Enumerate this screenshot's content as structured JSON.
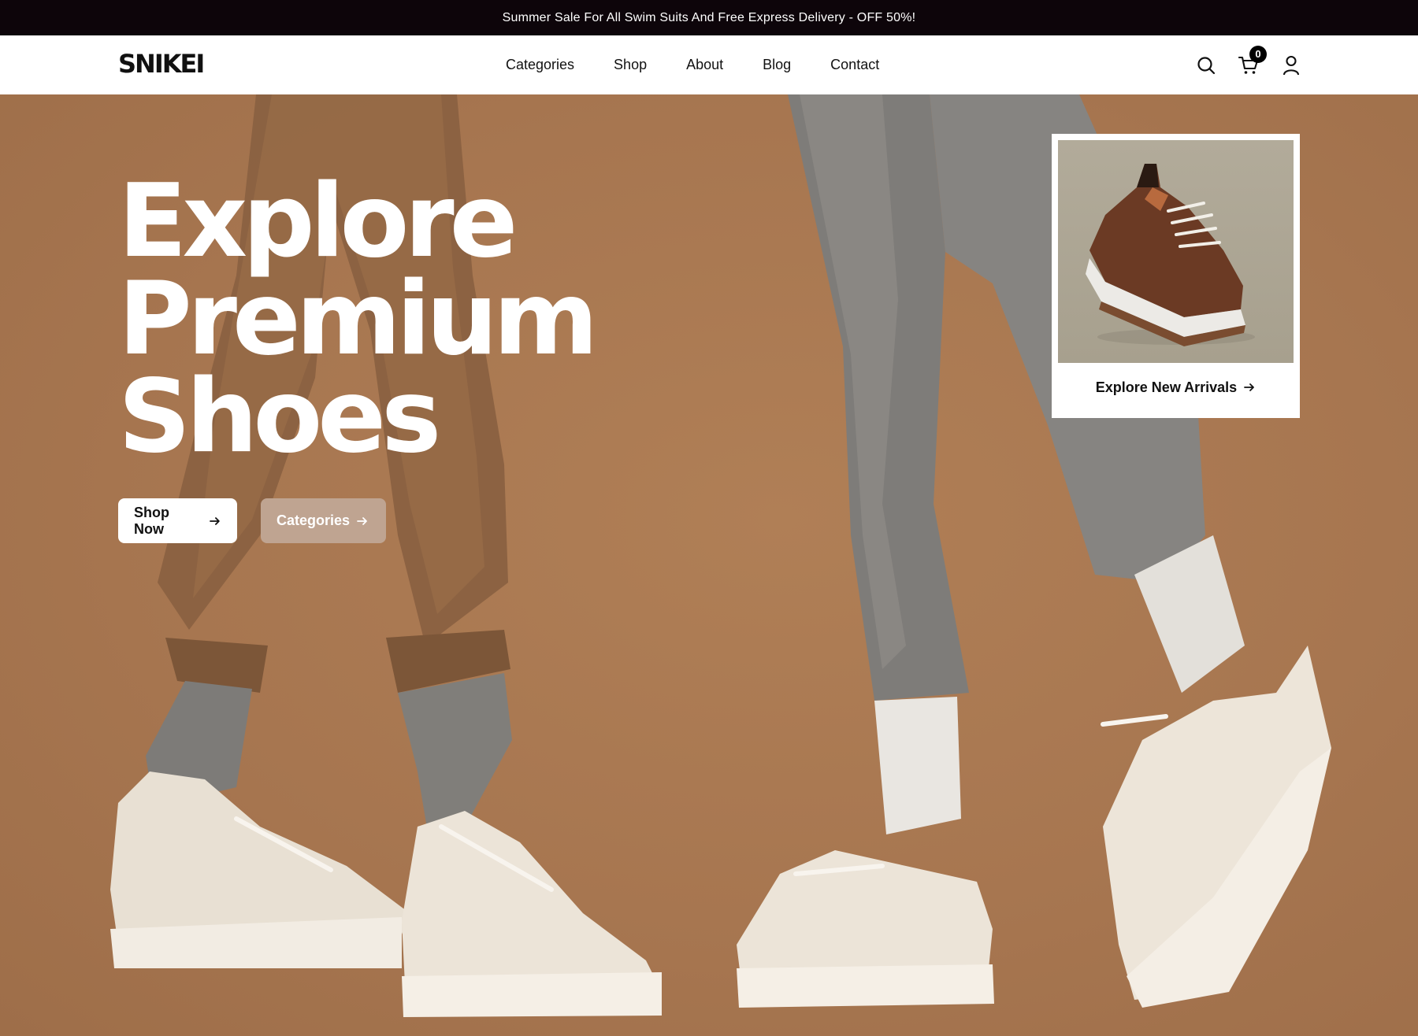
{
  "announcement": {
    "text": "Summer Sale For All Swim Suits And Free Express Delivery - OFF 50%!"
  },
  "header": {
    "logo": "SNIKEI",
    "nav": [
      "Categories",
      "Shop",
      "About",
      "Blog",
      "Contact"
    ],
    "cart_count": "0",
    "icons": [
      "search-icon",
      "cart-icon",
      "user-icon"
    ]
  },
  "hero": {
    "headline": [
      "Explore",
      "Premium",
      "Shoes"
    ],
    "buttons": {
      "shop_now": "Shop Now",
      "categories": "Categories"
    },
    "card": {
      "link": "Explore New Arrivals"
    }
  },
  "colors": {
    "announcement_bg": "#0d050a",
    "hero_bg": "#a8774f",
    "secondary_button": "#bfa491"
  }
}
